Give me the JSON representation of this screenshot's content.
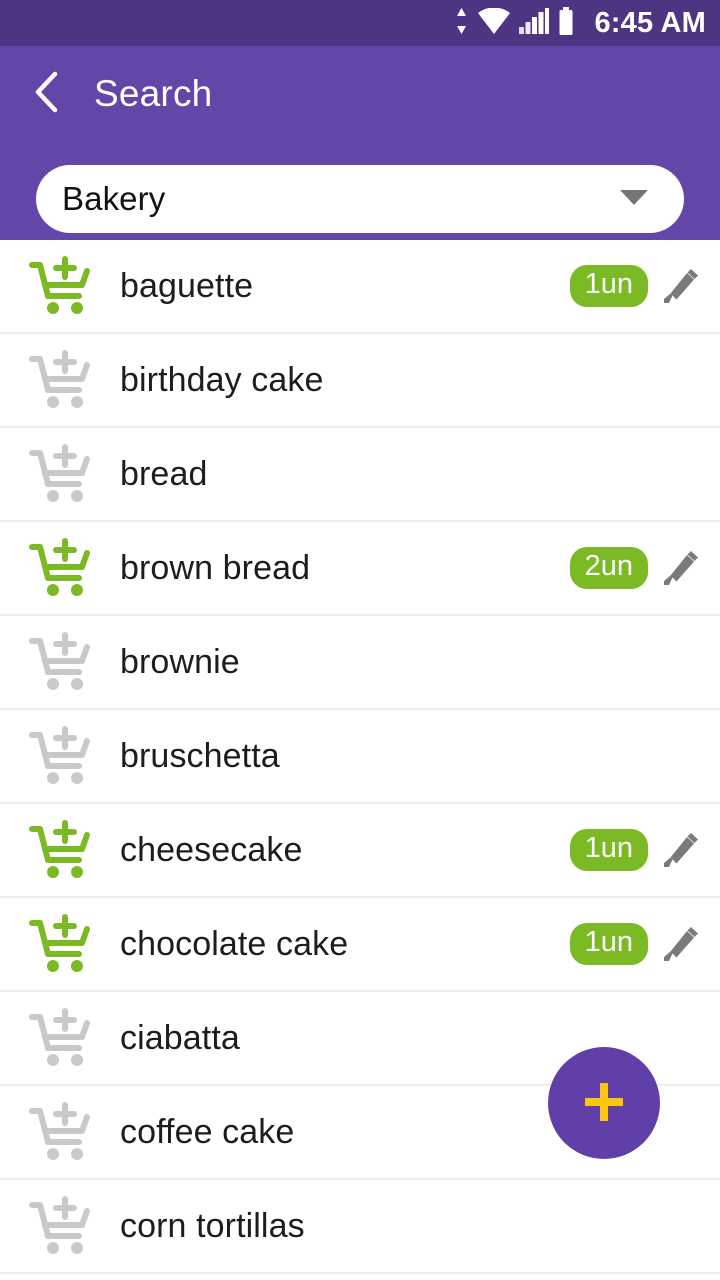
{
  "status_bar": {
    "time": "6:45 AM",
    "icons": [
      "data-transfer-arrows-icon",
      "wifi-icon",
      "cellular-signal-icon",
      "battery-icon"
    ],
    "background_color": "#4e3584",
    "foreground_color": "#ffffff"
  },
  "app_bar": {
    "title": "Search",
    "back_icon": "chevron-left-icon",
    "background_color": "#6445a8"
  },
  "category_dropdown": {
    "value": "Bakery",
    "placeholder": "Bakery",
    "caret_icon": "caret-down-icon"
  },
  "list": {
    "items": [
      {
        "name": "baguette",
        "in_cart": true,
        "quantity": "1un",
        "edit_icon": "pencil-icon",
        "cart_icon": "add-to-cart-icon"
      },
      {
        "name": "birthday cake",
        "in_cart": false,
        "quantity": "",
        "edit_icon": "pencil-icon",
        "cart_icon": "add-to-cart-icon"
      },
      {
        "name": "bread",
        "in_cart": false,
        "quantity": "",
        "edit_icon": "pencil-icon",
        "cart_icon": "add-to-cart-icon"
      },
      {
        "name": "brown bread",
        "in_cart": true,
        "quantity": "2un",
        "edit_icon": "pencil-icon",
        "cart_icon": "add-to-cart-icon"
      },
      {
        "name": "brownie",
        "in_cart": false,
        "quantity": "",
        "edit_icon": "pencil-icon",
        "cart_icon": "add-to-cart-icon"
      },
      {
        "name": "bruschetta",
        "in_cart": false,
        "quantity": "",
        "edit_icon": "pencil-icon",
        "cart_icon": "add-to-cart-icon"
      },
      {
        "name": "cheesecake",
        "in_cart": true,
        "quantity": "1un",
        "edit_icon": "pencil-icon",
        "cart_icon": "add-to-cart-icon"
      },
      {
        "name": "chocolate cake",
        "in_cart": true,
        "quantity": "1un",
        "edit_icon": "pencil-icon",
        "cart_icon": "add-to-cart-icon"
      },
      {
        "name": "ciabatta",
        "in_cart": false,
        "quantity": "",
        "edit_icon": "pencil-icon",
        "cart_icon": "add-to-cart-icon"
      },
      {
        "name": "coffee cake",
        "in_cart": false,
        "quantity": "",
        "edit_icon": "pencil-icon",
        "cart_icon": "add-to-cart-icon"
      },
      {
        "name": "corn tortillas",
        "in_cart": false,
        "quantity": "",
        "edit_icon": "pencil-icon",
        "cart_icon": "add-to-cart-icon"
      }
    ]
  },
  "fab": {
    "label": "+",
    "icon": "plus-icon",
    "background_color": "#6040a8",
    "icon_color": "#fcc511"
  },
  "colors": {
    "accent_purple": "#6445a8",
    "status_purple": "#4e3584",
    "cart_active_green": "#7cba25",
    "cart_inactive_gray": "#c9c9c9",
    "badge_green": "#7cba25",
    "pencil_gray": "#7a7a7a",
    "fab_yellow": "#fcc511",
    "divider": "#eeeeee",
    "text_primary": "#1d1d1d"
  }
}
